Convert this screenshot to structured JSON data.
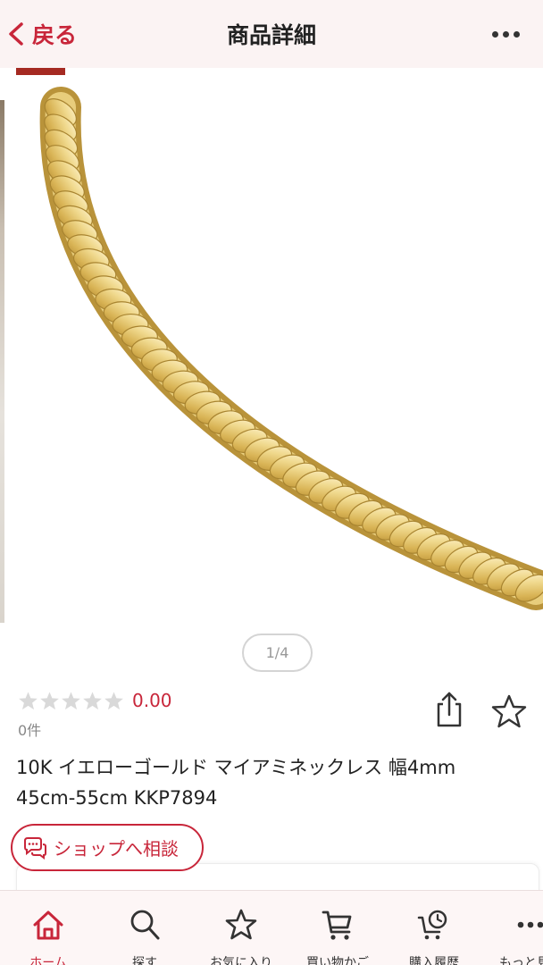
{
  "header": {
    "back_label": "戻る",
    "title": "商品詳細"
  },
  "gallery": {
    "pager": "1/4"
  },
  "product": {
    "rating_value": "0.00",
    "review_count": "0件",
    "stars_filled": 0,
    "stars_total": 5,
    "name_line1": "10K イエローゴールド マイアミネックレス 幅4mm",
    "name_line2": "45cm-55cm KKP7894"
  },
  "consult": {
    "label": "ショップへ相談"
  },
  "tabbar": {
    "items": [
      {
        "label": "ホーム",
        "icon": "home-icon",
        "active": true
      },
      {
        "label": "探す",
        "icon": "search-icon",
        "active": false
      },
      {
        "label": "お気に入り",
        "icon": "star-icon",
        "active": false
      },
      {
        "label": "買い物かご",
        "icon": "cart-icon",
        "active": false
      },
      {
        "label": "購入履歴",
        "icon": "history-icon",
        "active": false
      },
      {
        "label": "もっと見る",
        "icon": "more-icon",
        "active": false
      }
    ]
  },
  "colors": {
    "accent": "#c8263a",
    "header_bg": "#fbf3f3",
    "gold": "#e4c56a"
  }
}
